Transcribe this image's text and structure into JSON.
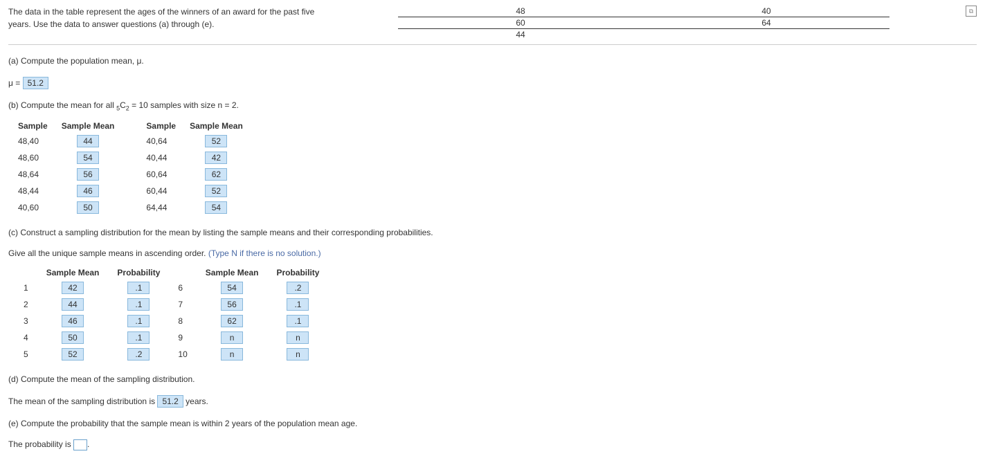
{
  "intro": {
    "text": "The data in the table represent the ages of the winners of an award for the past five years. Use the data to answer questions (a) through (e)."
  },
  "data_table": {
    "rows": [
      [
        "48",
        "40"
      ],
      [
        "60",
        "64"
      ],
      [
        "44",
        ""
      ]
    ]
  },
  "part_a": {
    "prompt": "(a) Compute the population mean, μ.",
    "label": "μ =",
    "value": "51.2"
  },
  "part_b": {
    "prompt_pre": "(b) Compute the mean for all ",
    "c_left": "5",
    "c_sym": "C",
    "c_right": "2",
    "prompt_post": " = 10 samples with size n = 2.",
    "headers": {
      "sample": "Sample",
      "mean": "Sample Mean"
    },
    "left": [
      {
        "sample": "48,40",
        "mean": "44"
      },
      {
        "sample": "48,60",
        "mean": "54"
      },
      {
        "sample": "48,64",
        "mean": "56"
      },
      {
        "sample": "48,44",
        "mean": "46"
      },
      {
        "sample": "40,60",
        "mean": "50"
      }
    ],
    "right": [
      {
        "sample": "40,64",
        "mean": "52"
      },
      {
        "sample": "40,44",
        "mean": "42"
      },
      {
        "sample": "60,64",
        "mean": "62"
      },
      {
        "sample": "60,44",
        "mean": "52"
      },
      {
        "sample": "64,44",
        "mean": "54"
      }
    ]
  },
  "part_c": {
    "prompt": "(c) Construct a sampling distribution for the mean by listing the sample means and their corresponding probabilities.",
    "instr_pre": "Give all the unique sample means in ascending order. ",
    "instr_hint": "(Type N if there is no solution.)",
    "headers": {
      "mean": "Sample Mean",
      "prob": "Probability"
    },
    "left": [
      {
        "idx": "1",
        "mean": "42",
        "prob": ".1"
      },
      {
        "idx": "2",
        "mean": "44",
        "prob": ".1"
      },
      {
        "idx": "3",
        "mean": "46",
        "prob": ".1"
      },
      {
        "idx": "4",
        "mean": "50",
        "prob": ".1"
      },
      {
        "idx": "5",
        "mean": "52",
        "prob": ".2"
      }
    ],
    "right": [
      {
        "idx": "6",
        "mean": "54",
        "prob": ".2"
      },
      {
        "idx": "7",
        "mean": "56",
        "prob": ".1"
      },
      {
        "idx": "8",
        "mean": "62",
        "prob": ".1"
      },
      {
        "idx": "9",
        "mean": "n",
        "prob": "n"
      },
      {
        "idx": "10",
        "mean": "n",
        "prob": "n"
      }
    ]
  },
  "part_d": {
    "prompt": "(d) Compute the mean of the sampling distribution.",
    "sentence_pre": "The mean of the sampling distribution is ",
    "value": "51.2",
    "sentence_post": " years."
  },
  "part_e": {
    "prompt": "(e) Compute the probability that the sample mean is within 2 years of the population mean age.",
    "sentence_pre": "The probability is ",
    "sentence_post": "."
  }
}
